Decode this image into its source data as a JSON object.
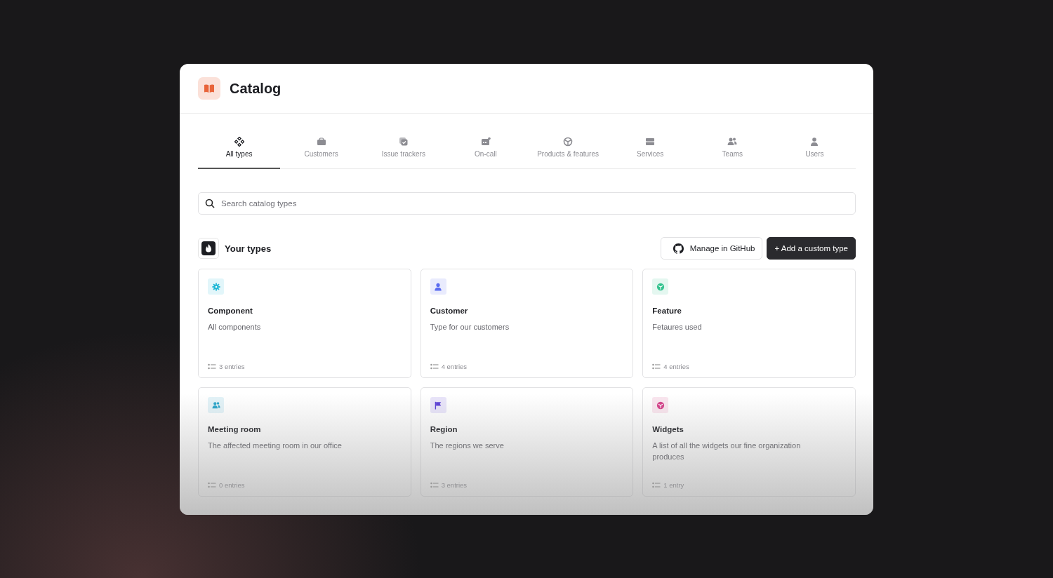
{
  "header": {
    "title": "Catalog"
  },
  "tabs": [
    {
      "label": "All types",
      "selected": true
    },
    {
      "label": "Customers",
      "selected": false
    },
    {
      "label": "Issue trackers",
      "selected": false
    },
    {
      "label": "On-call",
      "selected": false
    },
    {
      "label": "Products & features",
      "selected": false
    },
    {
      "label": "Services",
      "selected": false
    },
    {
      "label": "Teams",
      "selected": false
    },
    {
      "label": "Users",
      "selected": false
    }
  ],
  "search": {
    "placeholder": "Search catalog types"
  },
  "section": {
    "title": "Your types",
    "buttons": [
      {
        "label": "Manage in GitHub",
        "kind": "secondary"
      },
      {
        "label": "+ Add a custom type",
        "kind": "primary"
      }
    ]
  },
  "types": [
    {
      "name": "Component",
      "description": "All components",
      "entries": "3 entries",
      "color": "#22b8d6"
    },
    {
      "name": "Customer",
      "description": "Type for our customers",
      "entries": "4 entries",
      "color": "#5b6cf0"
    },
    {
      "name": "Feature",
      "description": "Fetaures used",
      "entries": "4 entries",
      "color": "#34c38f"
    },
    {
      "name": "Meeting room",
      "description": "The affected meeting room in our office",
      "entries": "0 entries",
      "color": "#2aa5c9"
    },
    {
      "name": "Region",
      "description": "The regions we serve",
      "entries": "3 entries",
      "color": "#5b3fd6"
    },
    {
      "name": "Widgets",
      "description": "A list of all the widgets our fine organization produces",
      "entries": "1 entry",
      "color": "#d6418a"
    }
  ]
}
